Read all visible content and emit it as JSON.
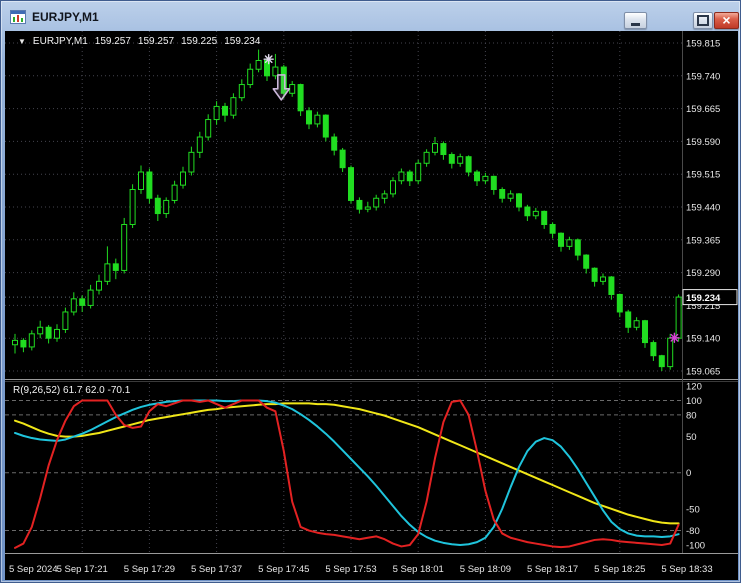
{
  "window": {
    "title": "EURJPY,M1"
  },
  "icons": {
    "collapse": "▼",
    "close": "×"
  },
  "colors": {
    "background": "#000000",
    "grid": "#44444e",
    "level": "#6a6a6a",
    "candle": "#21dd21",
    "bull_fill": "#000000",
    "axis_text": "#e8e8e8",
    "bid_line": "#5f6b75",
    "current_price_text": "#ffffff"
  },
  "chart": {
    "symbol_line": {
      "symbol": "EURJPY,M1",
      "open": "159.257",
      "high": "159.257",
      "low": "159.225",
      "close": "159.234"
    },
    "price_axis": {
      "labels": [
        "159.815",
        "159.740",
        "159.665",
        "159.590",
        "159.515",
        "159.440",
        "159.365",
        "159.290",
        "159.215",
        "159.140",
        "159.065"
      ],
      "current": "159.234",
      "current_value": 159.234
    },
    "time_axis": {
      "labels": [
        "5 Sep 2024",
        "5 Sep 17:21",
        "5 Sep 17:29",
        "5 Sep 17:37",
        "5 Sep 17:45",
        "5 Sep 17:53",
        "5 Sep 18:01",
        "5 Sep 18:09",
        "5 Sep 18:17",
        "5 Sep 18:25",
        "5 Sep 18:33"
      ]
    },
    "markers": [
      {
        "type": "star",
        "name": "sell-star-marker",
        "color": "#ded6ea",
        "x_bar": 30.2,
        "price": 159.778
      },
      {
        "type": "arrow-down",
        "name": "sell-arrow-marker",
        "color": "#cbb6da",
        "x_bar": 31.7,
        "price_top": 159.742,
        "price_tip": 159.685
      },
      {
        "type": "star",
        "name": "buy-star-marker",
        "color": "#d643d6",
        "x_bar": 78.5,
        "price": 159.141
      }
    ]
  },
  "indicator": {
    "label": "R(9,26,52) 61.7 62.0 -70.1",
    "name": "R",
    "params": "9,26,52",
    "values": [
      "61.7",
      "62.0",
      "-70.1"
    ],
    "axis_labels": [
      "120",
      "100",
      "80",
      "50",
      "0",
      "-50",
      "-80",
      "-100"
    ]
  },
  "chart_data": {
    "type": "candlestick",
    "symbol": "EURJPY",
    "timeframe": "M1",
    "price_range": {
      "max": 159.815,
      "min": 159.065,
      "step": 0.075
    },
    "candles": [
      [
        159.125,
        159.15,
        159.105,
        159.135
      ],
      [
        159.135,
        159.14,
        159.108,
        159.12
      ],
      [
        159.12,
        159.158,
        159.112,
        159.15
      ],
      [
        159.15,
        159.18,
        159.14,
        159.165
      ],
      [
        159.165,
        159.17,
        159.128,
        159.14
      ],
      [
        159.14,
        159.172,
        159.132,
        159.16
      ],
      [
        159.16,
        159.21,
        159.152,
        159.2
      ],
      [
        159.2,
        159.245,
        159.192,
        159.23
      ],
      [
        159.23,
        159.238,
        159.2,
        159.215
      ],
      [
        159.215,
        159.262,
        159.208,
        159.25
      ],
      [
        159.25,
        159.285,
        159.24,
        159.27
      ],
      [
        159.27,
        159.35,
        159.262,
        159.31
      ],
      [
        159.31,
        159.322,
        159.275,
        159.295
      ],
      [
        159.295,
        159.415,
        159.288,
        159.4
      ],
      [
        159.4,
        159.492,
        159.392,
        159.48
      ],
      [
        159.48,
        159.535,
        159.47,
        159.52
      ],
      [
        159.52,
        159.528,
        159.448,
        159.46
      ],
      [
        159.46,
        159.468,
        159.408,
        159.425
      ],
      [
        159.425,
        159.462,
        159.415,
        159.455
      ],
      [
        159.455,
        159.5,
        159.448,
        159.49
      ],
      [
        159.49,
        159.532,
        159.482,
        159.52
      ],
      [
        159.52,
        159.578,
        159.512,
        159.565
      ],
      [
        159.565,
        159.612,
        159.552,
        159.6
      ],
      [
        159.6,
        159.652,
        159.592,
        159.64
      ],
      [
        159.64,
        159.682,
        159.628,
        159.67
      ],
      [
        159.67,
        159.678,
        159.635,
        159.65
      ],
      [
        159.65,
        159.7,
        159.642,
        159.69
      ],
      [
        159.69,
        159.732,
        159.682,
        159.72
      ],
      [
        159.72,
        159.768,
        159.712,
        159.755
      ],
      [
        159.755,
        159.8,
        159.748,
        159.775
      ],
      [
        159.775,
        159.782,
        159.728,
        159.74
      ],
      [
        159.74,
        159.79,
        159.732,
        159.76
      ],
      [
        159.76,
        159.765,
        159.688,
        159.7
      ],
      [
        159.7,
        159.728,
        159.692,
        159.72
      ],
      [
        159.72,
        159.722,
        159.648,
        159.66
      ],
      [
        159.66,
        159.668,
        159.618,
        159.63
      ],
      [
        159.63,
        159.658,
        159.622,
        159.65
      ],
      [
        159.65,
        159.652,
        159.59,
        159.6
      ],
      [
        159.6,
        159.608,
        159.558,
        159.57
      ],
      [
        159.57,
        159.575,
        159.52,
        159.53
      ],
      [
        159.53,
        159.535,
        159.448,
        159.455
      ],
      [
        159.455,
        159.462,
        159.425,
        159.435
      ],
      [
        159.435,
        159.452,
        159.428,
        159.44
      ],
      [
        159.44,
        159.468,
        159.432,
        159.46
      ],
      [
        159.46,
        159.478,
        159.448,
        159.47
      ],
      [
        159.47,
        159.508,
        159.462,
        159.5
      ],
      [
        159.5,
        159.528,
        159.492,
        159.52
      ],
      [
        159.52,
        159.525,
        159.488,
        159.5
      ],
      [
        159.5,
        159.548,
        159.492,
        159.54
      ],
      [
        159.54,
        159.572,
        159.532,
        159.565
      ],
      [
        159.565,
        159.6,
        159.558,
        159.585
      ],
      [
        159.585,
        159.59,
        159.548,
        159.56
      ],
      [
        159.56,
        159.565,
        159.528,
        159.54
      ],
      [
        159.54,
        159.562,
        159.532,
        159.555
      ],
      [
        159.555,
        159.558,
        159.51,
        159.52
      ],
      [
        159.52,
        159.525,
        159.488,
        159.5
      ],
      [
        159.5,
        159.518,
        159.492,
        159.51
      ],
      [
        159.51,
        159.512,
        159.468,
        159.48
      ],
      [
        159.48,
        159.485,
        159.45,
        159.46
      ],
      [
        159.46,
        159.478,
        159.452,
        159.47
      ],
      [
        159.47,
        159.472,
        159.43,
        159.44
      ],
      [
        159.44,
        159.445,
        159.408,
        159.42
      ],
      [
        159.42,
        159.438,
        159.412,
        159.43
      ],
      [
        159.43,
        159.432,
        159.39,
        159.4
      ],
      [
        159.4,
        159.405,
        159.368,
        159.38
      ],
      [
        159.38,
        159.382,
        159.338,
        159.35
      ],
      [
        159.35,
        159.372,
        159.342,
        159.365
      ],
      [
        159.365,
        159.368,
        159.318,
        159.33
      ],
      [
        159.33,
        159.332,
        159.288,
        159.3
      ],
      [
        159.3,
        159.302,
        159.258,
        159.27
      ],
      [
        159.27,
        159.288,
        159.262,
        159.28
      ],
      [
        159.28,
        159.282,
        159.228,
        159.24
      ],
      [
        159.24,
        159.242,
        159.188,
        159.2
      ],
      [
        159.2,
        159.205,
        159.152,
        159.165
      ],
      [
        159.165,
        159.188,
        159.158,
        159.18
      ],
      [
        159.18,
        159.182,
        159.118,
        159.13
      ],
      [
        159.13,
        159.135,
        159.088,
        159.1
      ],
      [
        159.1,
        159.102,
        159.065,
        159.075
      ],
      [
        159.075,
        159.15,
        159.068,
        159.14
      ],
      [
        159.14,
        159.24,
        159.132,
        159.234
      ]
    ],
    "indicator": {
      "name": "R(9,26,52)",
      "range": {
        "max": 120,
        "min": -110
      },
      "levels": [
        100,
        80,
        0,
        -80
      ],
      "series": [
        {
          "name": "fast-red",
          "color": "#e32222",
          "values": [
            -104,
            -98,
            -75,
            -35,
            10,
            45,
            72,
            92,
            100,
            100,
            100,
            100,
            80,
            66,
            62,
            64,
            85,
            95,
            92,
            96,
            100,
            100,
            98,
            100,
            95,
            90,
            95,
            100,
            100,
            100,
            90,
            85,
            30,
            -40,
            -75,
            -80,
            -83,
            -85,
            -86,
            -88,
            -90,
            -92,
            -90,
            -88,
            -92,
            -98,
            -102,
            -100,
            -85,
            -40,
            20,
            70,
            98,
            100,
            80,
            30,
            -25,
            -65,
            -84,
            -90,
            -93,
            -96,
            -98,
            -100,
            -102,
            -103,
            -102,
            -99,
            -96,
            -93,
            -92,
            -93,
            -95,
            -96,
            -97,
            -98,
            -99,
            -100,
            -98,
            -72
          ]
        },
        {
          "name": "mid-cyan",
          "color": "#1fc4dc",
          "values": [
            55,
            51,
            48,
            46,
            45,
            44,
            46,
            50,
            54,
            59,
            65,
            71,
            77,
            82,
            87,
            91,
            94,
            96,
            98,
            99,
            100,
            100,
            100,
            100,
            100,
            99,
            99,
            100,
            100,
            100,
            99,
            97,
            93,
            88,
            81,
            73,
            64,
            54,
            43,
            31,
            19,
            7,
            -5,
            -18,
            -32,
            -46,
            -60,
            -72,
            -82,
            -89,
            -94,
            -97,
            -99,
            -100,
            -99,
            -96,
            -90,
            -75,
            -50,
            -20,
            8,
            30,
            43,
            48,
            45,
            36,
            22,
            5,
            -14,
            -33,
            -52,
            -68,
            -78,
            -84,
            -87,
            -88,
            -88,
            -89,
            -88,
            -85
          ]
        },
        {
          "name": "slow-yellow",
          "color": "#f0e618",
          "values": [
            72,
            68,
            63,
            58,
            54,
            51,
            50,
            50,
            51,
            53,
            55,
            58,
            61,
            64,
            67,
            70,
            73,
            75,
            77,
            79,
            81,
            83,
            85,
            87,
            88,
            90,
            91,
            92,
            93,
            94,
            95,
            95,
            96,
            96,
            96,
            96,
            95,
            95,
            94,
            92,
            90,
            88,
            85,
            82,
            79,
            75,
            71,
            67,
            63,
            58,
            53,
            48,
            43,
            38,
            33,
            28,
            23,
            18,
            13,
            8,
            3,
            -2,
            -7,
            -12,
            -17,
            -22,
            -27,
            -32,
            -37,
            -42,
            -46,
            -50,
            -54,
            -58,
            -61,
            -64,
            -67,
            -69,
            -70,
            -70
          ]
        }
      ]
    }
  }
}
